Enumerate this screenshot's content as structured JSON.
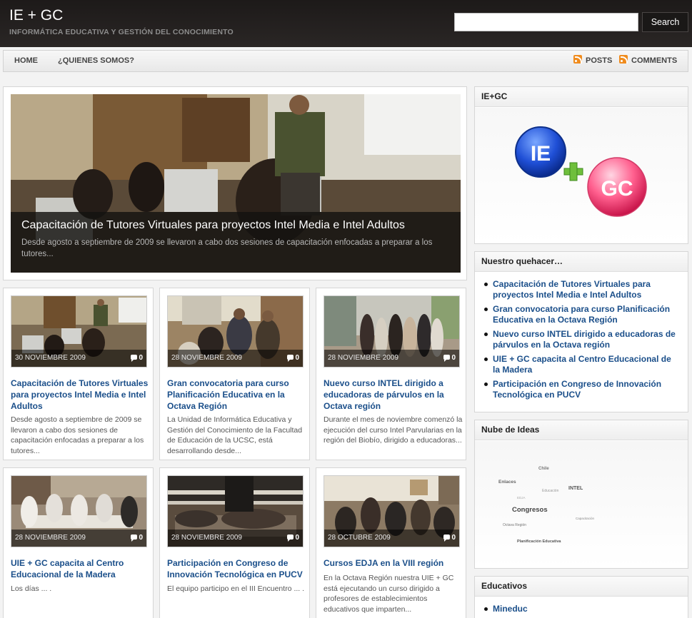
{
  "header": {
    "site_title": "IE + GC",
    "tagline": "INFORMÁTICA EDUCATIVA Y GESTIÓN DEL CONOCIMIENTO",
    "search_placeholder": "",
    "search_button": "Search"
  },
  "nav": {
    "left": [
      "HOME",
      "¿QUIENES SOMOS?"
    ],
    "right": [
      "POSTS",
      "COMMENTS"
    ]
  },
  "featured": {
    "title": "Capacitación de Tutores Virtuales para proyectos Intel Media e Intel Adultos",
    "excerpt": "Desde agosto a septiembre de 2009 se llevaron a cabo dos sesiones de capacitación enfocadas a preparar a los tutores..."
  },
  "posts": [
    {
      "date": "30 NOVIEMBRE 2009",
      "comments": "0",
      "title": "Capacitación de Tutores Virtuales para proyectos Intel Media e Intel Adultos",
      "excerpt": "Desde agosto a septiembre de 2009 se llevaron a cabo dos sesiones de capacitación enfocadas a preparar  a los tutores..."
    },
    {
      "date": "28 NOVIEMBRE 2009",
      "comments": "0",
      "title": "Gran convocatoria para curso Planificación Educativa en la Octava Región",
      "excerpt": "La Unidad de Informática Educativa y Gestión del Conocimiento de la Facultad de Educación de la UCSC, está desarrollando desde..."
    },
    {
      "date": "28 NOVIEMBRE 2009",
      "comments": "0",
      "title": "Nuevo curso INTEL dirigido a educadoras de párvulos en la Octava región",
      "excerpt": "Durante el mes de noviembre comenzó la ejecución del curso Intel Parvularias en la región del Biobío, dirigido a educadoras..."
    },
    {
      "date": "28 NOVIEMBRE 2009",
      "comments": "0",
      "title": "UIE + GC capacita al Centro Educacional de la Madera",
      "excerpt": "Los días ... ."
    },
    {
      "date": "28 NOVIEMBRE 2009",
      "comments": "0",
      "title": "Participación en Congreso de Innovación Tecnológica en PUCV",
      "excerpt": "El equipo participo en el III Encuentro ... ."
    },
    {
      "date": "28 OCTUBRE 2009",
      "comments": "0",
      "title": "Cursos EDJA en la VIII región",
      "excerpt": "En la Octava Región nuestra UIE + GC está ejecutando un curso dirigido a profesores de establecimientos educativos que imparten..."
    }
  ],
  "sidebar": {
    "logo_widget": {
      "title": "IE+GC",
      "logo_left": "IE",
      "logo_right": "GC"
    },
    "quehacer": {
      "title": "Nuestro quehacer…",
      "items": [
        "Capacitación de Tutores Virtuales para proyectos Intel Media e Intel Adultos",
        "Gran convocatoria para curso Planificación Educativa en la Octava Región",
        "Nuevo curso INTEL dirigido a educadoras de párvulos en la Octava región",
        "UIE + GC capacita al Centro Educacional de la Madera",
        "Participación en Congreso de Innovación Tecnológica en PUCV"
      ]
    },
    "cloud": {
      "title": "Nube de Ideas",
      "words": [
        "Chile",
        "Enlaces",
        "Educación",
        "INTEL",
        "EDJA",
        "Congresos",
        "Capacitación",
        "Octava Región",
        "Planificación Educativa"
      ]
    },
    "educativos": {
      "title": "Educativos",
      "items": [
        "Mineduc"
      ]
    }
  },
  "colors": {
    "link": "#1b4f8a",
    "header_bg": "#1d1a19",
    "rss": "#f08c1e"
  }
}
